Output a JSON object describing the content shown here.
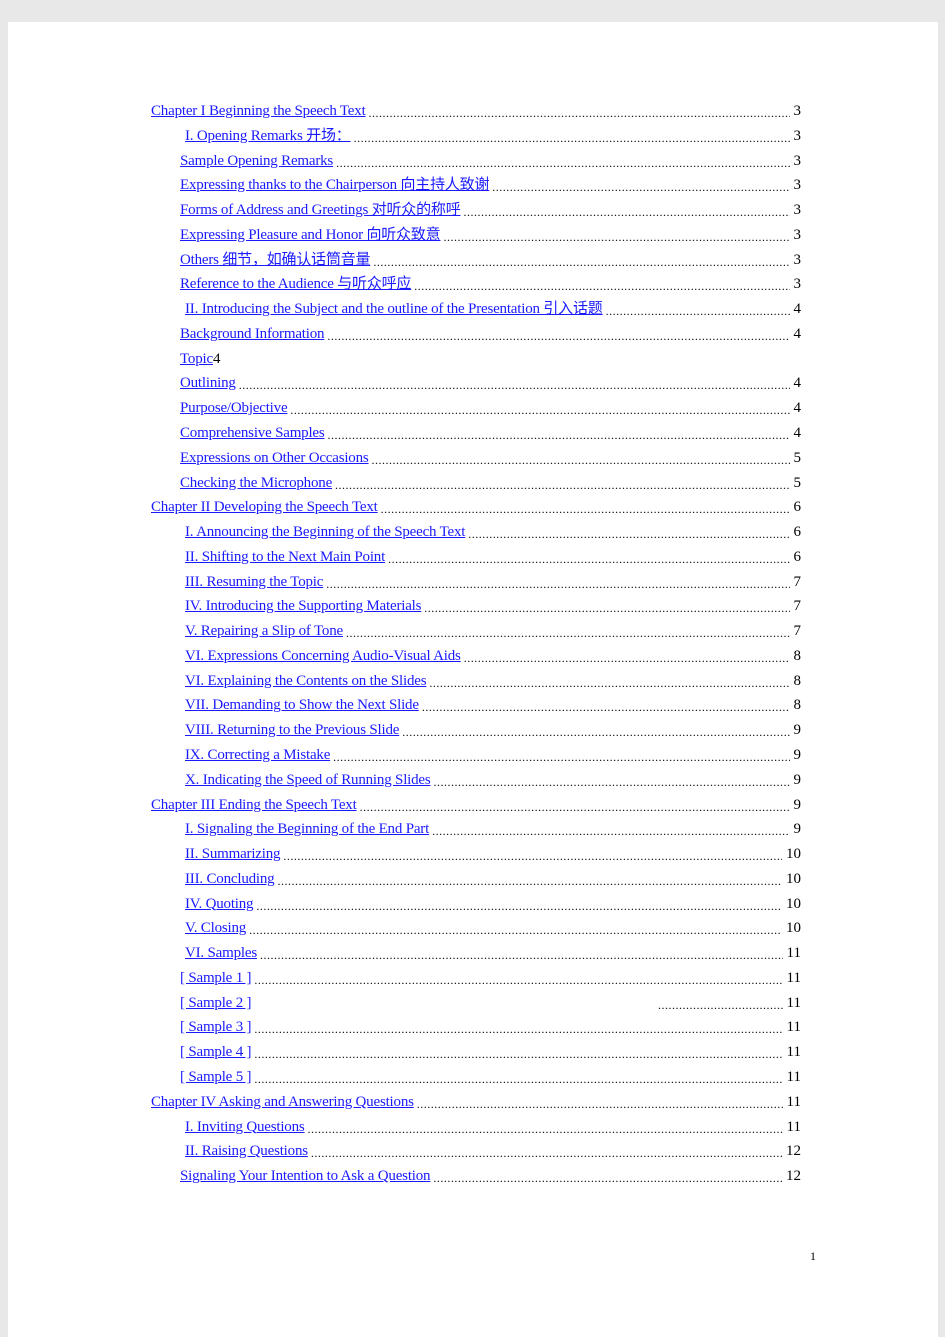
{
  "toc": [
    {
      "text": "Chapter I Beginning the Speech Text",
      "page": "3",
      "level": 0
    },
    {
      "text": "I. Opening Remarks 开场： ",
      "page": "3",
      "level": 2
    },
    {
      "text": "Sample Opening Remarks",
      "page": "3",
      "level": 1
    },
    {
      "text": "Expressing thanks to the Chairperson  向主持人致谢",
      "page": "3",
      "level": 1
    },
    {
      "text": "Forms of Address and Greetings 对听众的称呼",
      "page": "3",
      "level": 1
    },
    {
      "text": "Expressing Pleasure and Honor  向听众致意",
      "page": "3",
      "level": 1
    },
    {
      "text": "Others  细节，如确认话筒音量",
      "page": "3",
      "level": 1
    },
    {
      "text": "Reference to the Audience  与听众呼应",
      "page": "3",
      "level": 1
    },
    {
      "text": "II. Introducing the Subject and the outline of the Presentation 引入话题",
      "page": "4",
      "level": 2
    },
    {
      "text": "Background Information",
      "page": "4",
      "level": 1
    },
    {
      "text": "Topic",
      "page": "4",
      "level": 1,
      "nodots": true
    },
    {
      "text": "Outlining",
      "page": "4",
      "level": 1
    },
    {
      "text": "Purpose/Objective",
      "page": "4",
      "level": 1
    },
    {
      "text": "Comprehensive Samples",
      "page": "4",
      "level": 1
    },
    {
      "text": "Expressions on Other Occasions",
      "page": "5",
      "level": 1
    },
    {
      "text": "Checking the Microphone",
      "page": "5",
      "level": 1
    },
    {
      "text": "Chapter II Developing the Speech Text",
      "page": "6",
      "level": 0
    },
    {
      "text": "I. Announcing the Beginning of the Speech Text",
      "page": "6",
      "level": 2
    },
    {
      "text": "II. Shifting to the Next Main Point",
      "page": "6",
      "level": 2
    },
    {
      "text": "III. Resuming the Topic",
      "page": "7",
      "level": 2
    },
    {
      "text": "IV. Introducing the Supporting Materials",
      "page": "7",
      "level": 2
    },
    {
      "text": "V. Repairing a Slip of Tone",
      "page": "7",
      "level": 2
    },
    {
      "text": "VI. Expressions Concerning Audio-Visual Aids",
      "page": "8",
      "level": 2
    },
    {
      "text": "VI. Explaining the Contents on the Slides",
      "page": "8",
      "level": 2
    },
    {
      "text": "VII. Demanding to Show the Next Slide",
      "page": "8",
      "level": 2
    },
    {
      "text": "VIII. Returning to the Previous Slide",
      "page": "9",
      "level": 2
    },
    {
      "text": "IX. Correcting a Mistake",
      "page": "9",
      "level": 2
    },
    {
      "text": "X. Indicating the Speed of Running Slides",
      "page": "9",
      "level": 2
    },
    {
      "text": "Chapter III Ending the Speech Text",
      "page": "9",
      "level": 0
    },
    {
      "text": "I. Signaling the Beginning of the End Part",
      "page": "9",
      "level": 2
    },
    {
      "text": "II. Summarizing",
      "page": "10",
      "level": 2
    },
    {
      "text": "III. Concluding",
      "page": "10",
      "level": 2
    },
    {
      "text": "IV. Quoting",
      "page": "10",
      "level": 2
    },
    {
      "text": "V. Closing",
      "page": "10",
      "level": 2
    },
    {
      "text": "VI. Samples",
      "page": "11",
      "level": 2
    },
    {
      "text": "[ Sample 1 ]",
      "page": "11",
      "level": 1
    },
    {
      "text": "[ Sample 2 ]",
      "page": "11",
      "level": 1,
      "long": true
    },
    {
      "text": "[ Sample 3 ]",
      "page": "11",
      "level": 1
    },
    {
      "text": "[ Sample 4 ]",
      "page": "11",
      "level": 1
    },
    {
      "text": "[ Sample 5 ]",
      "page": "11",
      "level": 1
    },
    {
      "text": "Chapter IV Asking and Answering Questions",
      "page": "11",
      "level": 0
    },
    {
      "text": "I. Inviting Questions",
      "page": "11",
      "level": 2
    },
    {
      "text": "II. Raising Questions",
      "page": "12",
      "level": 2
    },
    {
      "text": "Signaling Your Intention to Ask a Question",
      "page": "12",
      "level": 1
    }
  ],
  "page_number": "1",
  "colors": {
    "link": "#1a1aff",
    "text": "#000000"
  }
}
